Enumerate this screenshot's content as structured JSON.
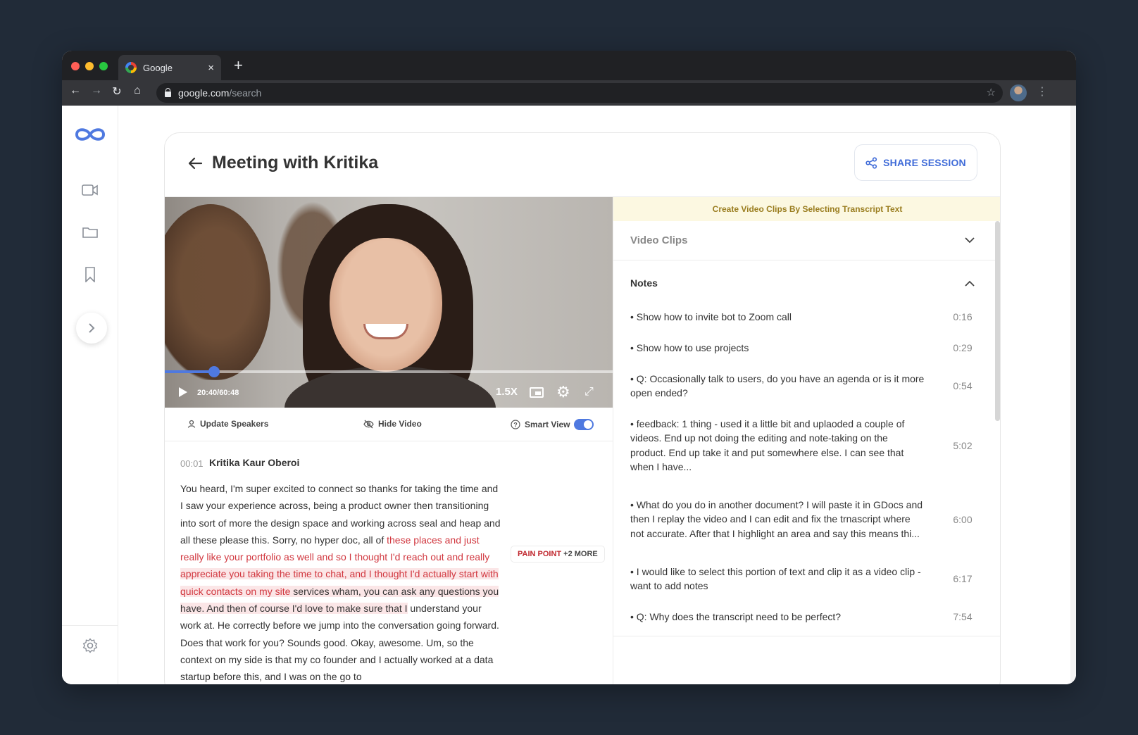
{
  "browser": {
    "tab_title": "Google",
    "tab_close": "×",
    "new_tab": "+",
    "url_host": "google.com",
    "url_path": "/search",
    "back": "←",
    "forward": "→",
    "reload": "↻",
    "home": "⌂",
    "star": "☆",
    "menu": "⋮"
  },
  "header": {
    "title": "Meeting with Kritika",
    "share_label": "SHARE SESSION"
  },
  "video": {
    "time": "20:40/60:48",
    "speed": "1.5X",
    "progress": 0.11
  },
  "video_toolbar": {
    "update_speakers": "Update Speakers",
    "hide_video": "Hide Video",
    "smart_view": "Smart View",
    "smart_view_on": true
  },
  "transcript": {
    "time": "00:01",
    "speaker": "Kritika Kaur Oberoi",
    "text_before": "You heard, I'm super excited to connect so thanks for taking the time and I saw your experience across, being a product owner then transitioning into sort of more the design space and working across seal and heap and all these please this. Sorry, no hyper doc, all of ",
    "text_highlight_a": "these places and just really like your portfolio as well and so I thought I'd reach out and really ",
    "text_highlight_b": "appreciate you taking the time to chat, and I thought I'd actually start with quick contacts on my site",
    "text_highlight_c": " services wham, you can ask any questions you have. And then of course I'd love to make sure that I",
    "text_after": " understand your work at. He correctly before we jump into the conversation going forward. Does that work for you? Sounds good. Okay, awesome. Um, so the context on my side is that my co founder and I actually worked at a data startup before this, and I was on the go to",
    "tag_label": "PAIN POINT",
    "tag_more": "+2 MORE"
  },
  "right_panel": {
    "banner": "Create Video Clips By Selecting Transcript Text",
    "video_clips_label": "Video Clips",
    "notes_label": "Notes",
    "notes": [
      {
        "text": "• Show how to invite bot to Zoom call",
        "time": "0:16"
      },
      {
        "text": "• Show how to use projects",
        "time": "0:29"
      },
      {
        "text": "• Q: Occasionally talk to users, do you have an agenda or is it more open ended?",
        "time": "0:54"
      },
      {
        "text": "• feedback: 1 thing - used it a little bit and uplaoded a couple of videos. End up not doing the editing and note-taking on the product. End up take it and put somewhere else. I can see that when I have...",
        "time": "5:02"
      },
      {
        "text": "• What do you do in another document? I will paste it in GDocs and then I replay the video and I can edit and fix the trnascript where not accurate. After that I highlight an area and say this means thi...",
        "time": "6:00"
      },
      {
        "text": "• I would like to select this portion of text and clip it as a video clip - want to add notes",
        "time": "6:17"
      },
      {
        "text": "• Q: Why does the transcript need to be perfect?",
        "time": "7:54"
      }
    ]
  },
  "colors": {
    "accent": "#4f79e0",
    "highlight_text": "#d1373f",
    "highlight_bg": "#fbe6e7",
    "banner_bg": "#fcf8e1",
    "page_bg": "#212b38"
  }
}
